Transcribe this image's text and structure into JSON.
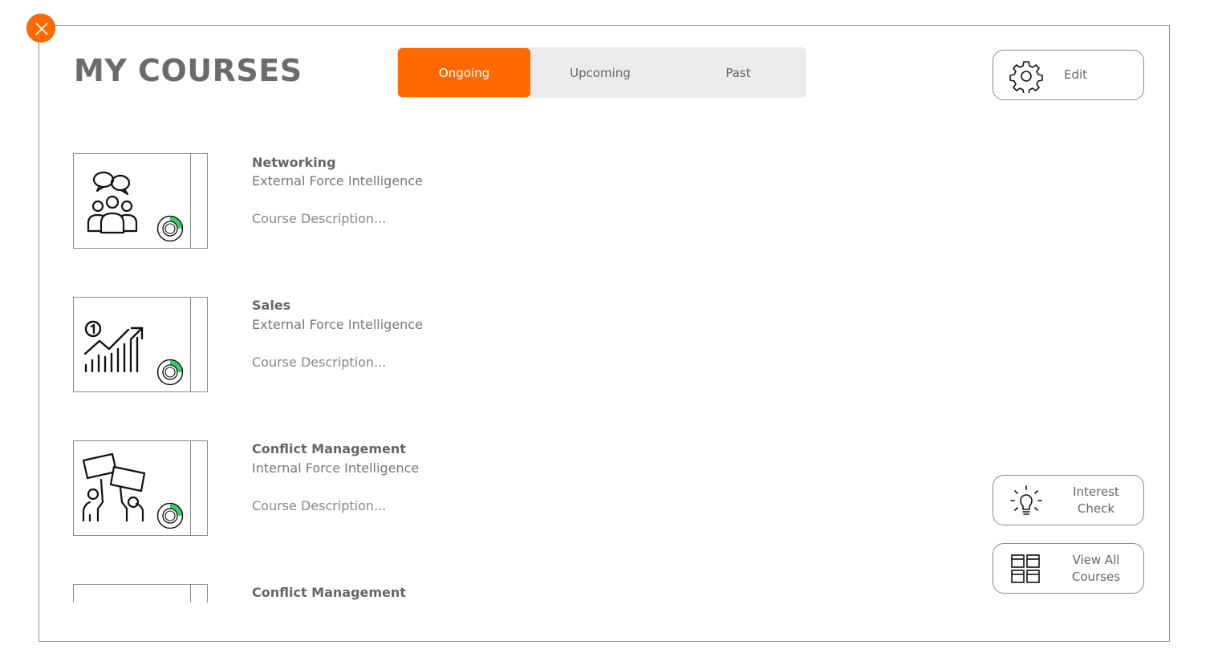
{
  "header": {
    "title": "MY COURSES"
  },
  "tabs": [
    {
      "label": "Ongoing",
      "active": true
    },
    {
      "label": "Upcoming",
      "active": false
    },
    {
      "label": "Past",
      "active": false
    }
  ],
  "buttons": {
    "edit": {
      "label": "Edit",
      "icon": "gear-icon"
    },
    "interest": {
      "label_line1": "Interest",
      "label_line2": "Check",
      "icon": "lightbulb-icon"
    },
    "view_all": {
      "label_line1": "View All",
      "label_line2": "Courses",
      "icon": "grid-icon"
    }
  },
  "courses": [
    {
      "title": "Networking",
      "category": "External Force Intelligence",
      "description": "Course Description...",
      "icon": "people-chat-icon",
      "progress": 0.25
    },
    {
      "title": "Sales",
      "category": "External Force Intelligence",
      "description": "Course Description...",
      "icon": "growth-chart-icon",
      "progress": 0.25
    },
    {
      "title": "Conflict Management",
      "category": "Internal Force Intelligence",
      "description": "Course Description...",
      "icon": "protest-icon",
      "progress": 0.25
    },
    {
      "title": "Conflict Management",
      "category": "",
      "description": "",
      "icon": "person-icon",
      "progress": 0
    }
  ],
  "colors": {
    "accent": "#ff6a00",
    "progress": "#3dcb6e",
    "text": "#666666",
    "tab_bg": "#ebebeb"
  }
}
